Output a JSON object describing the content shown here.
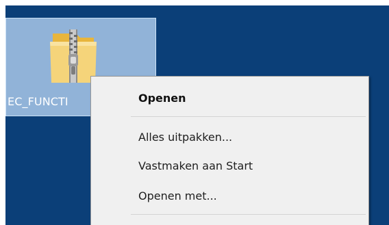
{
  "desktop": {
    "background_color": "#0b3f78",
    "selected_icon": {
      "icon": "zip-folder-icon",
      "label": "EC_FUNCTI"
    }
  },
  "context_menu": {
    "items": [
      {
        "label": "Openen",
        "default": true
      },
      {
        "label": "Alles uitpakken..."
      },
      {
        "label": "Vastmaken aan Start"
      },
      {
        "label": "Openen met..."
      }
    ]
  }
}
